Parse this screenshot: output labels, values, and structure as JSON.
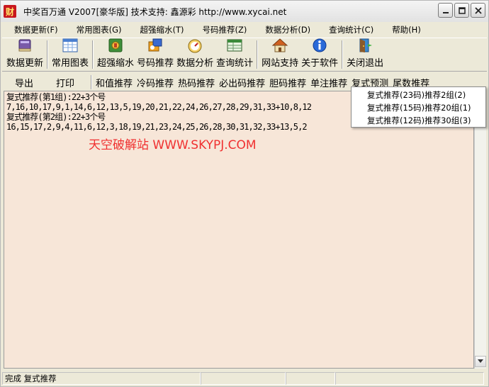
{
  "window": {
    "title": "中奖百万通   V2007[豪华版]  技术支持: 鑫源彩 http://www.xycai.net",
    "app_icon_glyph": "财",
    "controls": {
      "minimize": "_",
      "maximize": "□",
      "close": "✕"
    }
  },
  "menu": [
    "数据更新(F)",
    "常用图表(G)",
    "超强缩水(T)",
    "号码推荐(Z)",
    "数据分析(D)",
    "查询统计(C)",
    "帮助(H)"
  ],
  "toolbar": [
    {
      "label": "数据更新",
      "icon": "book-icon"
    },
    {
      "label": "常用图表",
      "icon": "chart-grid-icon"
    },
    {
      "label": "超强缩水",
      "icon": "shrink-icon"
    },
    {
      "label": "号码推荐",
      "icon": "recommend-icon"
    },
    {
      "label": "数据分析",
      "icon": "gauge-icon"
    },
    {
      "label": "查询统计",
      "icon": "query-table-icon"
    },
    {
      "label": "网站支持",
      "icon": "home-icon"
    },
    {
      "label": "关于软件",
      "icon": "info-icon"
    },
    {
      "label": "关闭退出",
      "icon": "exit-door-icon"
    }
  ],
  "subbar": [
    "导出",
    "打印",
    "和值推荐",
    "冷码推荐",
    "热码推荐",
    "必出码推荐",
    "胆码推荐",
    "单注推荐",
    "复式预测",
    "尾数推荐"
  ],
  "content": {
    "lines": [
      "复式推荐(第1组):22+3个号",
      "7,16,10,17,9,1,14,6,12,13,5,19,20,21,22,24,26,27,28,29,31,33+10,8,12",
      "复式推荐(第2组):22+3个号",
      "16,15,17,2,9,4,11,6,12,3,18,19,21,23,24,25,26,28,30,31,32,33+13,5,2"
    ],
    "watermark": "天空破解站 WWW.SKYPJ.COM"
  },
  "popup_menu": [
    "复式推荐(23码)推荐2组(2)",
    "复式推荐(15码)推荐20组(1)",
    "复式推荐(12码)推荐30组(3)"
  ],
  "status": {
    "text": "完成 复式推荐"
  },
  "colors": {
    "content_bg": "#f7e6d8",
    "watermark": "#f03030",
    "window_bg": "#ece9d8"
  }
}
